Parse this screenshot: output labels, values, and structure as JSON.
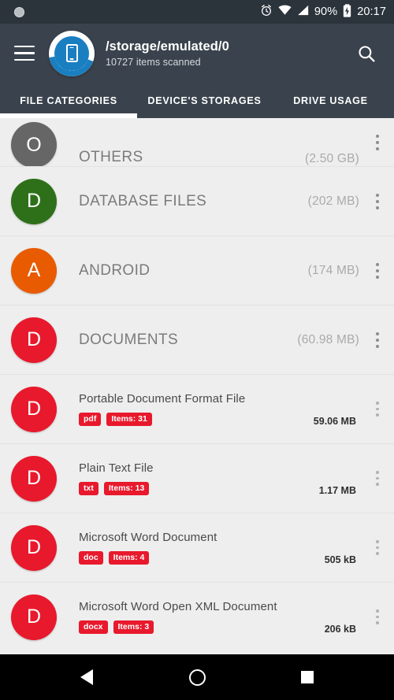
{
  "status_bar": {
    "left_icon": "dot-indicator",
    "alarm_icon": "alarm-clock-icon",
    "wifi_icon": "wifi-icon",
    "signal_icon": "cell-signal-icon",
    "battery_level": "90%",
    "battery_icon": "battery-charging-icon",
    "time": "20:17"
  },
  "toolbar": {
    "menu_icon": "hamburger-menu-icon",
    "app_icon": "device-storage-icon",
    "title": "/storage/emulated/0",
    "subtitle": "10727 items scanned",
    "search_icon": "search-icon"
  },
  "tabs": {
    "active_index": 0,
    "items": [
      {
        "label": "FILE CATEGORIES"
      },
      {
        "label": "DEVICE'S STORAGES"
      },
      {
        "label": "DRIVE USAGE"
      }
    ]
  },
  "list": {
    "categories": [
      {
        "initial": "O",
        "color": "#666666",
        "label": "OTHERS",
        "size": "(2.50 GB)",
        "clipped": true
      },
      {
        "initial": "D",
        "color": "#2e7019",
        "label": "DATABASE FILES",
        "size": "(202 MB)",
        "clipped": false
      },
      {
        "initial": "A",
        "color": "#e85b00",
        "label": "ANDROID",
        "size": "(174 MB)",
        "clipped": false
      },
      {
        "initial": "D",
        "color": "#e8192c",
        "label": "DOCUMENTS",
        "size": "(60.98 MB)",
        "clipped": false
      }
    ],
    "files": [
      {
        "initial": "D",
        "color": "#e8192c",
        "title": "Portable Document Format File",
        "ext_badge": "pdf",
        "items_badge": "Items: 31",
        "size": "59.06 MB"
      },
      {
        "initial": "D",
        "color": "#e8192c",
        "title": "Plain Text File",
        "ext_badge": "txt",
        "items_badge": "Items: 13",
        "size": "1.17 MB"
      },
      {
        "initial": "D",
        "color": "#e8192c",
        "title": "Microsoft Word Document",
        "ext_badge": "doc",
        "items_badge": "Items: 4",
        "size": "505 kB"
      },
      {
        "initial": "D",
        "color": "#e8192c",
        "title": "Microsoft Word Open XML Document",
        "ext_badge": "docx",
        "items_badge": "Items: 3",
        "size": "206 kB"
      }
    ],
    "overflow_icon": "kebab-menu-icon"
  },
  "nav_bar": {
    "back_icon": "nav-back-icon",
    "home_icon": "nav-home-icon",
    "recents_icon": "nav-recents-icon"
  },
  "colors": {
    "status_bar_bg": "#2b333b",
    "toolbar_bg": "#3a434d",
    "accent_blue": "#1a7fc1",
    "badge_red": "#e8192c",
    "list_bg": "#eeeeee"
  }
}
